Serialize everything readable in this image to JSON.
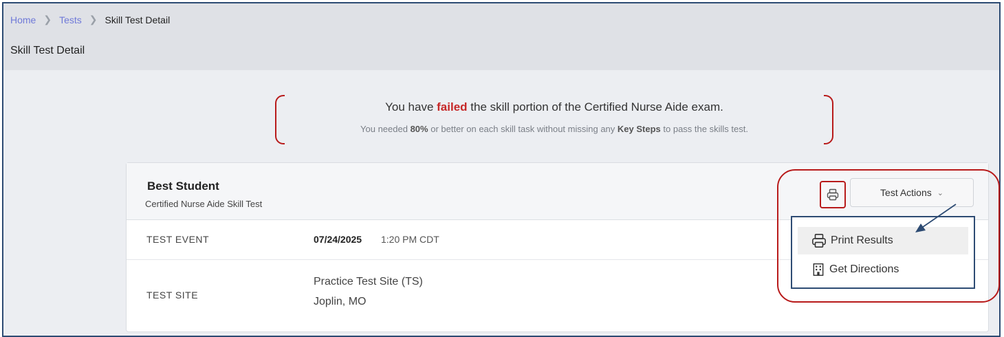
{
  "breadcrumb": {
    "home": "Home",
    "tests": "Tests",
    "current": "Skill Test Detail"
  },
  "page_title": "Skill Test Detail",
  "notice": {
    "line1_pre": "You have ",
    "line1_fail": "failed",
    "line1_post": " the skill portion of the Certified Nurse Aide exam.",
    "line2_a": "You needed ",
    "line2_pct": "80%",
    "line2_b": " or better on each skill task without missing any ",
    "line2_key": "Key Steps",
    "line2_c": " to pass the skills test."
  },
  "card": {
    "student_name": "Best Student",
    "test_name": "Certified Nurse Aide Skill Test",
    "event_label": "TEST EVENT",
    "event_date": "07/24/2025",
    "event_time": "1:20 PM CDT",
    "site_label": "TEST SITE",
    "site_name": "Practice Test Site (TS)",
    "site_city": "Joplin, MO"
  },
  "actions": {
    "button_label": "Test Actions",
    "menu": [
      "Print Results",
      "Get Directions"
    ]
  },
  "icons": {
    "print": "printer-icon",
    "directions": "building-icon",
    "chevron": "chevron-down-icon"
  },
  "colors": {
    "fail": "#c62828",
    "link": "#6f79d8",
    "annotation_red": "#b81a1a",
    "annotation_blue": "#2d4b73"
  }
}
